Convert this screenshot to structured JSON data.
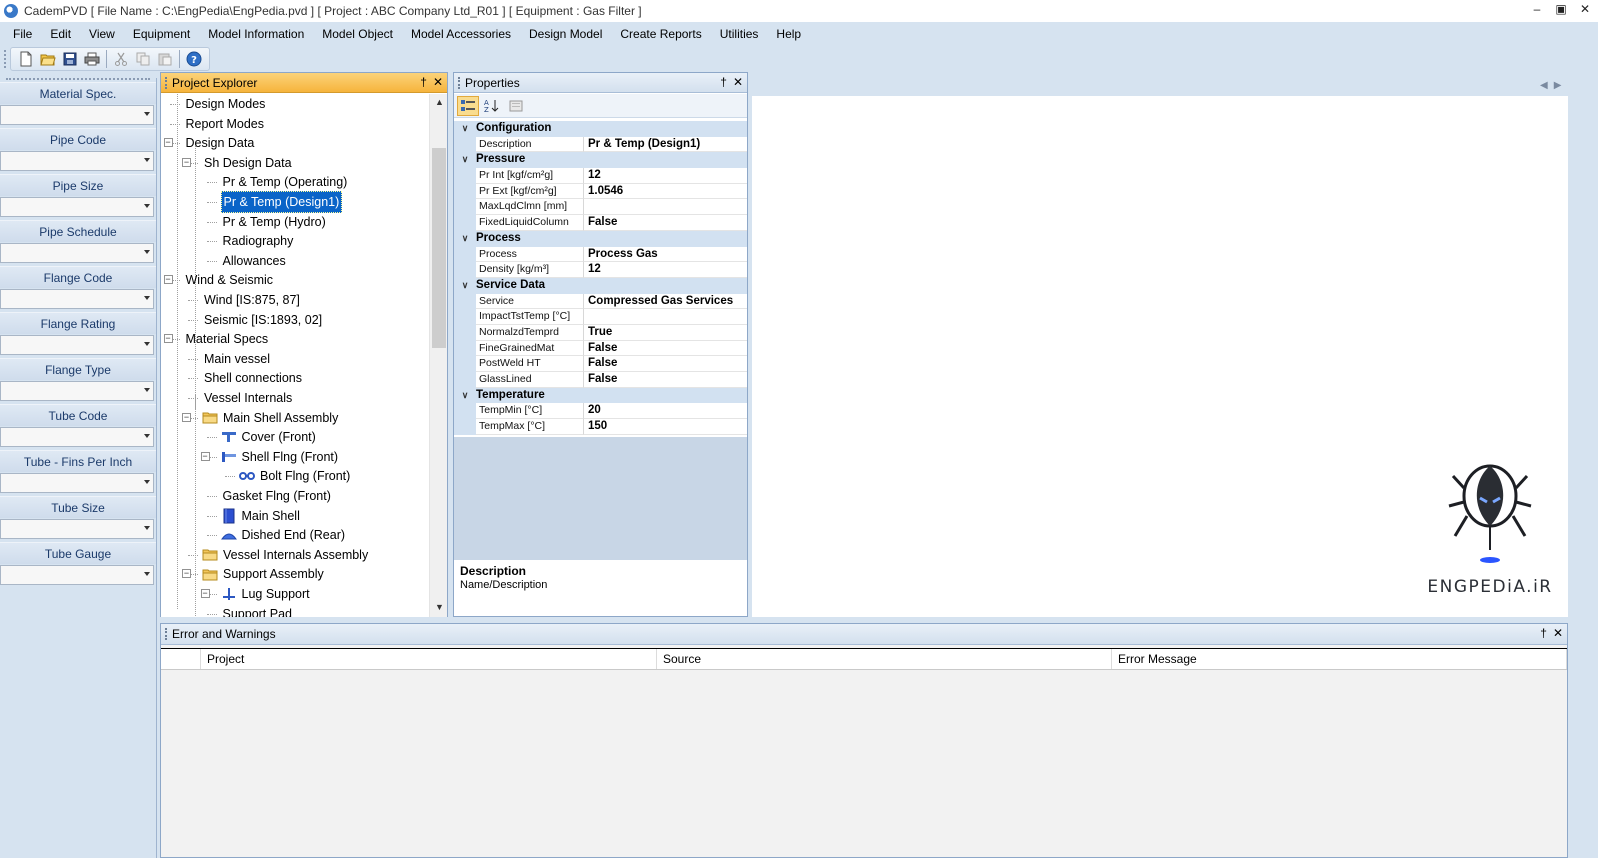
{
  "window": {
    "title": "CademPVD [ File Name : C:\\EngPedia\\EngPedia.pvd ] [ Project : ABC Company Ltd_R01 ] [ Equipment : Gas Filter ]",
    "controls": {
      "minimize": "–",
      "maximize": "▣",
      "close": "✕"
    }
  },
  "menu": [
    "File",
    "Edit",
    "View",
    "Equipment",
    "Model Information",
    "Model Object",
    "Model Accessories",
    "Design Model",
    "Create Reports",
    "Utilities",
    "Help"
  ],
  "toolbar": {
    "buttons": [
      "new-file-icon",
      "open-folder-icon",
      "save-icon",
      "print-icon",
      "cut-icon",
      "copy-icon",
      "paste-icon",
      "help-icon"
    ]
  },
  "left_panel": {
    "fields": [
      {
        "label": "Material Spec.",
        "value": ""
      },
      {
        "label": "Pipe Code",
        "value": ""
      },
      {
        "label": "Pipe Size",
        "value": ""
      },
      {
        "label": "Pipe Schedule",
        "value": ""
      },
      {
        "label": "Flange Code",
        "value": ""
      },
      {
        "label": "Flange Rating",
        "value": ""
      },
      {
        "label": "Flange Type",
        "value": ""
      },
      {
        "label": "Tube Code",
        "value": ""
      },
      {
        "label": "Tube - Fins Per Inch",
        "value": ""
      },
      {
        "label": "Tube Size",
        "value": ""
      },
      {
        "label": "Tube Gauge",
        "value": ""
      }
    ]
  },
  "explorer": {
    "title": "Project Explorer",
    "pin": "†",
    "close": "✕",
    "nodes": [
      {
        "label": "Design Modes",
        "icon": "",
        "selected": false
      },
      {
        "label": "Report Modes",
        "icon": "",
        "selected": false
      },
      {
        "label": "Design Data",
        "icon": "",
        "selected": false
      },
      {
        "label": "Sh Design Data",
        "icon": "",
        "selected": false
      },
      {
        "label": "Pr & Temp (Operating)",
        "icon": "",
        "selected": false
      },
      {
        "label": "Pr & Temp (Design1)",
        "icon": "",
        "selected": true
      },
      {
        "label": "Pr & Temp (Hydro)",
        "icon": "",
        "selected": false
      },
      {
        "label": "Radiography",
        "icon": "",
        "selected": false
      },
      {
        "label": "Allowances",
        "icon": "",
        "selected": false
      },
      {
        "label": "Wind & Seismic",
        "icon": "",
        "selected": false
      },
      {
        "label": "Wind [IS:875, 87]",
        "icon": "",
        "selected": false
      },
      {
        "label": "Seismic [IS:1893, 02]",
        "icon": "",
        "selected": false
      },
      {
        "label": "Material Specs",
        "icon": "",
        "selected": false
      },
      {
        "label": "Main vessel",
        "icon": "",
        "selected": false
      },
      {
        "label": "Shell connections",
        "icon": "",
        "selected": false
      },
      {
        "label": "Vessel Internals",
        "icon": "",
        "selected": false
      },
      {
        "label": "Main Shell Assembly",
        "icon": "folder-icon",
        "selected": false
      },
      {
        "label": "Cover (Front)",
        "icon": "cover-icon",
        "selected": false
      },
      {
        "label": "Shell Flng (Front)",
        "icon": "flange-icon",
        "selected": false
      },
      {
        "label": "Bolt Flng (Front)",
        "icon": "bolt-icon",
        "selected": false
      },
      {
        "label": "Gasket Flng (Front)",
        "icon": "",
        "selected": false
      },
      {
        "label": "Main Shell",
        "icon": "shell-icon",
        "selected": false
      },
      {
        "label": "Dished End (Rear)",
        "icon": "dished-end-icon",
        "selected": false
      },
      {
        "label": "Vessel Internals Assembly",
        "icon": "folder-icon",
        "selected": false
      },
      {
        "label": "Support Assembly",
        "icon": "folder-icon",
        "selected": false
      },
      {
        "label": "Lug Support",
        "icon": "lug-icon",
        "selected": false
      },
      {
        "label": "Support Pad",
        "icon": "",
        "selected": false
      }
    ]
  },
  "properties": {
    "title": "Properties",
    "pin": "†",
    "close": "✕",
    "categories": [
      {
        "name": "Configuration",
        "rows": [
          {
            "name": "Description",
            "value": "Pr & Temp (Design1)"
          }
        ]
      },
      {
        "name": "Pressure",
        "rows": [
          {
            "name": "Pr Int [kgf/cm²g]",
            "value": "12"
          },
          {
            "name": "Pr Ext [kgf/cm²g]",
            "value": "1.0546"
          },
          {
            "name": "MaxLqdClmn [mm]",
            "value": ""
          },
          {
            "name": "FixedLiquidColumn",
            "value": "False"
          }
        ]
      },
      {
        "name": "Process",
        "rows": [
          {
            "name": "Process",
            "value": "Process Gas"
          },
          {
            "name": "Density [kg/m³]",
            "value": "12"
          }
        ]
      },
      {
        "name": "Service Data",
        "rows": [
          {
            "name": "Service",
            "value": "Compressed Gas Services"
          },
          {
            "name": "ImpactTstTemp [°C]",
            "value": ""
          },
          {
            "name": "NormalzdTemprd",
            "value": "True"
          },
          {
            "name": "FineGrainedMat",
            "value": "False"
          },
          {
            "name": "PostWeld HT",
            "value": "False"
          },
          {
            "name": "GlassLined",
            "value": "False"
          }
        ]
      },
      {
        "name": "Temperature",
        "rows": [
          {
            "name": "TempMin [°C]",
            "value": "20"
          },
          {
            "name": "TempMax [°C]",
            "value": "150"
          }
        ]
      }
    ],
    "help": {
      "title": "Description",
      "text": "Name/Description"
    }
  },
  "logo": {
    "text": "ENGPEDiA.iR"
  },
  "errors": {
    "title": "Error and Warnings",
    "pin": "†",
    "close": "✕",
    "columns": [
      "",
      "Project",
      "Source",
      "Error Message"
    ]
  },
  "colors": {
    "background": "#d6e3f0",
    "active_header": "#f6b43c",
    "selection": "#0a64c8",
    "category": "#d2e1f1"
  }
}
